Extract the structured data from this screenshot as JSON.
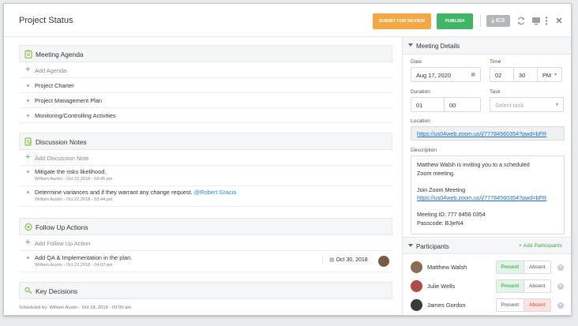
{
  "header": {
    "title": "Project Status",
    "submit_label": "SUBMIT FOR REVIEW",
    "publish_label": "PUBLISH",
    "ics_label": "ICS"
  },
  "colors": {
    "submit": "#f5a743",
    "publish": "#3fb567",
    "accent_green": "#4bae4f",
    "link": "#1f6fc5"
  },
  "agenda": {
    "title": "Meeting Agenda",
    "add_label": "Add Agenda",
    "items": [
      "Project Charter",
      "Project Management Plan",
      "Monitoring/Controlling Activities"
    ]
  },
  "notes": {
    "title": "Discussion Notes",
    "add_label": "Add Discussion Note",
    "items": [
      {
        "text": "Mitigate the risks likelihood.",
        "mention": "",
        "meta": "William Austin - Oct 22,2018 - 03:45 pm"
      },
      {
        "text": "Determine variances and if they warrant any change request.",
        "mention": "@Robert Gracia",
        "meta": "William Austin - Oct 22,2018 - 03:44 pm"
      }
    ]
  },
  "followup": {
    "title": "Follow Up Actions",
    "add_label": "Add Follow Up Action",
    "items": [
      {
        "text": "Add QA & Implementation in the plan.",
        "meta": "William Austin - Oct 22,2018 - 04:02 pm",
        "date": "Oct 30, 2018"
      }
    ]
  },
  "decisions": {
    "title": "Key Decisions"
  },
  "footer": {
    "scheduled": "Scheduled by: William Austin - Oct 18, 2018 - 09:00 am"
  },
  "details": {
    "title": "Meeting Details",
    "date_label": "Date",
    "date_value": "Aug 17, 2020",
    "time_label": "Time",
    "time_hour": "02",
    "time_min": "30",
    "time_ampm": "PM",
    "duration_label": "Duration",
    "duration_h": "01",
    "duration_m": "00",
    "task_label": "Task",
    "task_placeholder": "Select task",
    "location_label": "Location",
    "location_value": "https://us04web.zoom.us/j/77784560354?pwd=bFR",
    "description_label": "Description",
    "description": {
      "line1": "Matthew Walsh is inviting you to a scheduled",
      "line2": "Zoom meeting.",
      "line3": "Join Zoom Meeting",
      "line4": "https://us04web.zoom.us/j/77784560354?pwd=bFR",
      "line5": "Meeting ID: 777 8456 0354",
      "line6": "Passcode: BJjeN4"
    }
  },
  "participants": {
    "title": "Participants",
    "add_label": "+ Add Participants",
    "present_label": "Present",
    "absent_label": "Absent",
    "people": [
      {
        "name": "Matthew Walsh",
        "status": "Present"
      },
      {
        "name": "Julie Wells",
        "status": "Present"
      },
      {
        "name": "James Gordon",
        "status": "Absent"
      }
    ]
  }
}
